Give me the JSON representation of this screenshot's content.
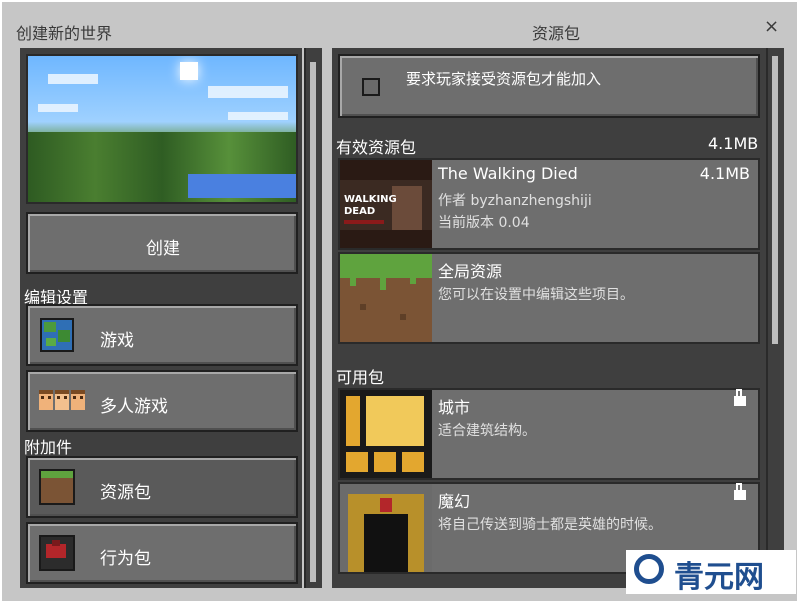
{
  "header": {
    "left_title": "创建新的世界",
    "center_title": "资源包",
    "close_symbol": "×"
  },
  "left": {
    "create_label": "创建",
    "edit_settings_heading": "编辑设置",
    "game_label": "游戏",
    "multiplayer_label": "多人游戏",
    "addons_heading": "附加件",
    "resource_packs_label": "资源包",
    "behavior_packs_label": "行为包",
    "icons": {
      "game": "globe-icon",
      "multiplayer": "players-icon",
      "resource_packs": "grass-block-icon",
      "behavior_packs": "behavior-pack-icon"
    }
  },
  "right": {
    "require_label": "要求玩家接受资源包才能加入",
    "active_heading": "有效资源包",
    "active_size": "4.1MB",
    "active_packs": [
      {
        "name": "The Walking Died",
        "size": "4.1MB",
        "author": "作者 byzhanzhengshiji",
        "version": "当前版本 0.04",
        "thumb_text": "WALKING DEAD"
      },
      {
        "name": "全局资源",
        "desc": "您可以在设置中编辑这些项目。"
      }
    ],
    "available_heading": "可用包",
    "available_packs": [
      {
        "name": "城市",
        "desc": "适合建筑结构。"
      },
      {
        "name": "魔幻",
        "desc": "将自己传送到骑士都是英雄的时候。"
      }
    ]
  },
  "watermark": {
    "text": "青元网"
  },
  "colors": {
    "frame": "#c6c6c6",
    "panel": "#3f3f3f",
    "button": "#6e6e6e",
    "watermark": "#1f4e8f"
  }
}
